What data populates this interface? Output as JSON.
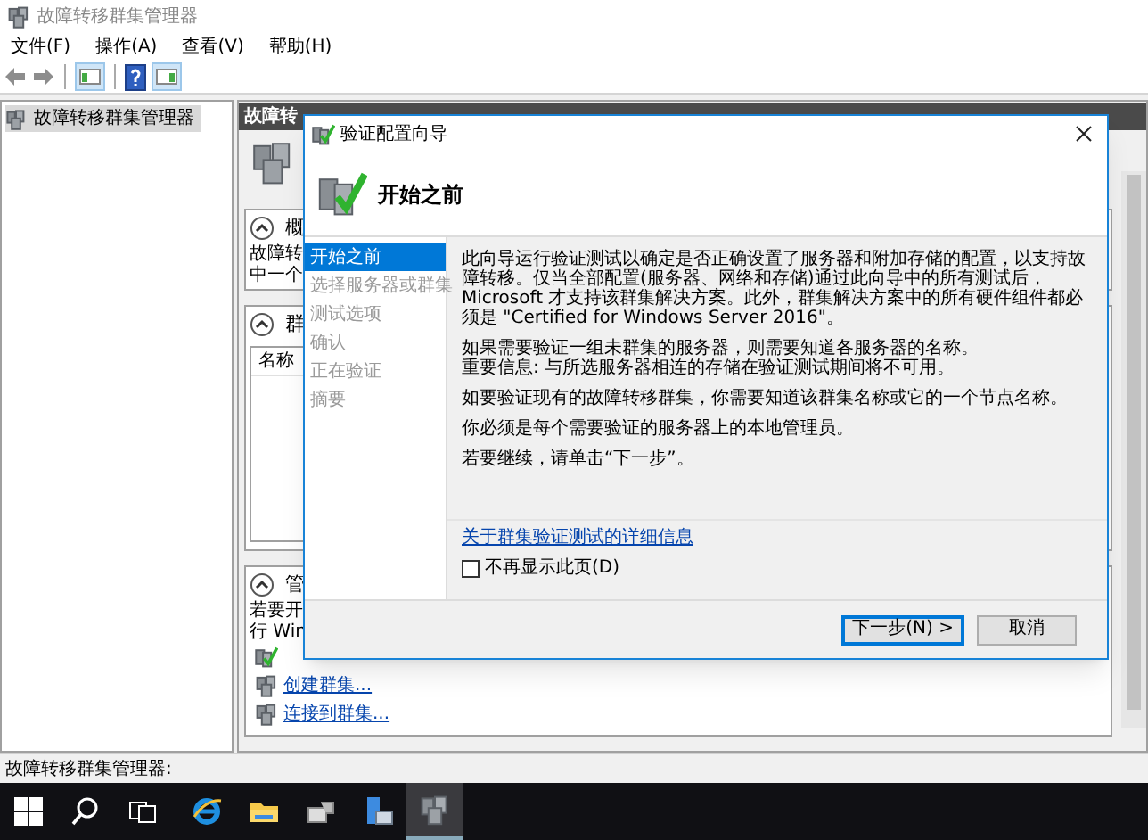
{
  "window": {
    "title": "故障转移群集管理器"
  },
  "menu": [
    {
      "label": "文件(F)"
    },
    {
      "label": "操作(A)"
    },
    {
      "label": "查看(V)"
    },
    {
      "label": "帮助(H)"
    }
  ],
  "tree": {
    "items": [
      {
        "label": "故障转移群集管理器",
        "selected": true
      }
    ]
  },
  "main_panel": {
    "header": "故障转",
    "sections": [
      {
        "kind": "text",
        "title": "概",
        "lines": [
          "故障转",
          "中一个"
        ]
      },
      {
        "kind": "table",
        "title": "群",
        "columns": [
          "名称"
        ]
      },
      {
        "kind": "actions",
        "title": "管",
        "lines": [
          "若要开",
          "行 Win"
        ],
        "links": [
          {
            "label": "创建群集..."
          },
          {
            "label": "连接到群集..."
          }
        ]
      }
    ]
  },
  "dialog": {
    "title": "验证配置向导",
    "heading": "开始之前",
    "steps": [
      {
        "label": "开始之前",
        "selected": true
      },
      {
        "label": "选择服务器或群集",
        "selected": false
      },
      {
        "label": "测试选项",
        "selected": false
      },
      {
        "label": "确认",
        "selected": false
      },
      {
        "label": "正在验证",
        "selected": false
      },
      {
        "label": "摘要",
        "selected": false
      }
    ],
    "paragraphs": [
      {
        "lines": [
          "此向导运行验证测试以确定是否正确设置了服务器和附加存储的配置，以支持故障转移。仅当全部配置(服务器、网络和存储)通过此向导中的所有测试后，Microsoft 才支持该群集解决方案。此外，群集解决方案中的所有硬件组件都必须是 \"Certified for Windows Server 2016\"。"
        ]
      },
      {
        "lines": [
          "如果需要验证一组未群集的服务器，则需要知道各服务器的名称。",
          "重要信息: 与所选服务器相连的存储在验证测试期间将不可用。"
        ]
      },
      {
        "lines": [
          "如要验证现有的故障转移群集，你需要知道该群集名称或它的一个节点名称。"
        ]
      },
      {
        "lines": [
          "你必须是每个需要验证的服务器上的本地管理员。"
        ]
      },
      {
        "lines": [
          "若要继续，请单击“下一步”。"
        ]
      }
    ],
    "link": "关于群集验证测试的详细信息",
    "checkbox": {
      "label": "不再显示此页(D)",
      "checked": false
    },
    "buttons": [
      {
        "label": "下一步(N) >",
        "kind": "default"
      },
      {
        "label": "取消",
        "kind": "normal"
      }
    ]
  },
  "status_bar": {
    "text": "故障转移群集管理器:"
  }
}
